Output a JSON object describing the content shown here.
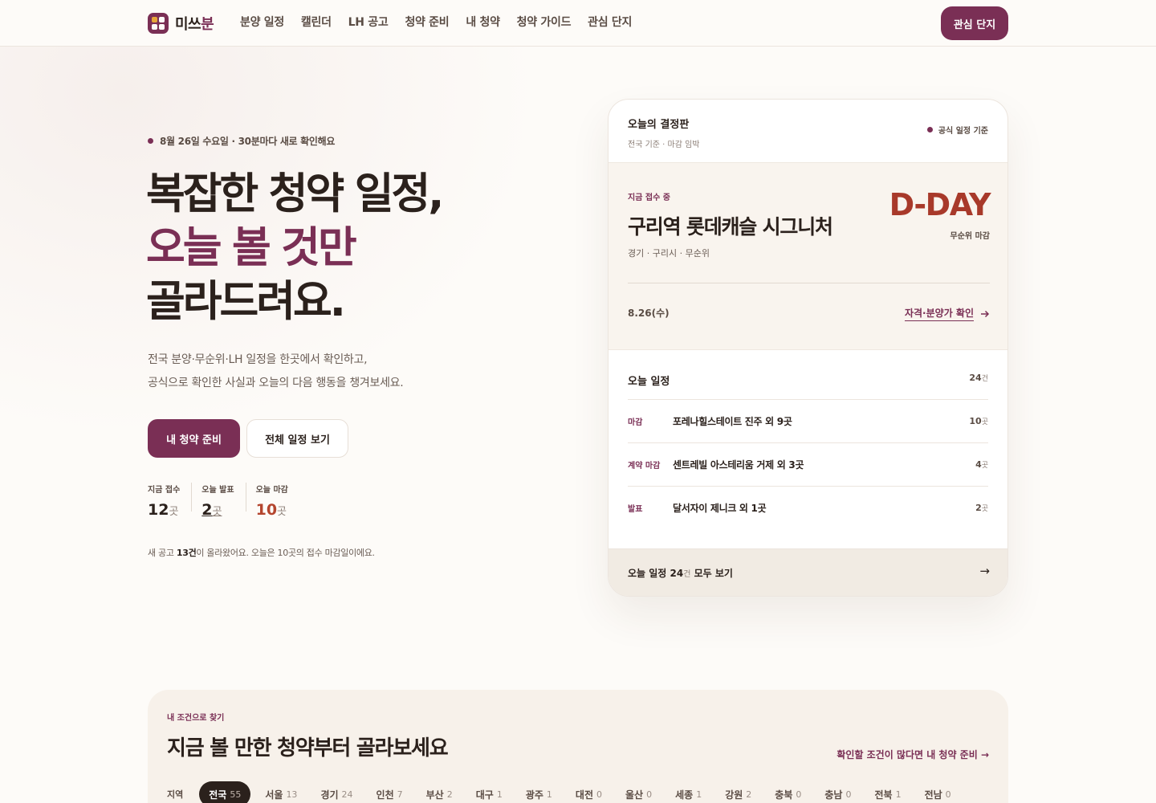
{
  "brand": {
    "name_a": "미쓰",
    "name_b": "분"
  },
  "nav": {
    "links": [
      "분양 일정",
      "캘린더",
      "LH 공고",
      "청약 준비",
      "내 청약",
      "청약 가이드",
      "관심 단지"
    ],
    "cta": "관심 단지"
  },
  "hero": {
    "eyebrow": "8월 26일 수요일 · 30분마다 새로 확인해요",
    "headline_1": "복잡한 청약 일정,",
    "headline_2": "오늘 볼 것만",
    "headline_3": "골라드려요.",
    "lead_1": "전국 분양·무순위·LH 일정을 한곳에서 확인하고,",
    "lead_2": "공식으로 확인한 사실과 오늘의 다음 행동을 챙겨보세요.",
    "primary_button": "내 청약 준비",
    "secondary_button": "전체 일정 보기",
    "stats": [
      {
        "label": "지금 접수",
        "value": "12",
        "unit": "곳"
      },
      {
        "label": "오늘 발표",
        "value": "2",
        "unit": "곳"
      },
      {
        "label": "오늘 마감",
        "value": "10",
        "unit": "곳"
      }
    ],
    "note_pre": "새 공고 ",
    "note_bold": "13건",
    "note_post": "이 올라왔어요. 오늘은 10곳의 접수 마감일이에요."
  },
  "board": {
    "title": "오늘의 결정판",
    "subtitle": "전국 기준 · 마감 임박",
    "basis": "공식 일정 기준",
    "featured": {
      "status": "지금 접수 중",
      "name": "구리역 롯데캐슬 시그니처",
      "location": "경기 · 구리시 · 무순위",
      "dday": "D-DAY",
      "dday_caption": "무순위 마감",
      "date": "8.26(수)",
      "link": "자격·분양가 확인"
    },
    "today_title": "오늘 일정",
    "today_count": "24",
    "today_unit": "건",
    "rows": [
      {
        "tag": "마감",
        "name": "포레나힐스테이트 진주 외 9곳",
        "count": "10",
        "unit": "곳"
      },
      {
        "tag": "계약 마감",
        "name": "센트레빌 아스테리움 거제 외 3곳",
        "count": "4",
        "unit": "곳"
      },
      {
        "tag": "발표",
        "name": "달서자이 제니크 외 1곳",
        "count": "2",
        "unit": "곳"
      }
    ],
    "footer_pre": "오늘 일정 ",
    "footer_num": "24",
    "footer_unit": "건",
    "footer_post": " 모두 보기",
    "footer_arrow": "→"
  },
  "filter": {
    "eyebrow": "내 조건으로 찾기",
    "title": "지금 볼 만한 청약부터 골라보세요",
    "link": "확인할 조건이 많다면 내 청약 준비 →",
    "region_label": "지역",
    "regions": [
      {
        "name": "전국",
        "count": "55"
      },
      {
        "name": "서울",
        "count": "13"
      },
      {
        "name": "경기",
        "count": "24"
      },
      {
        "name": "인천",
        "count": "7"
      },
      {
        "name": "부산",
        "count": "2"
      },
      {
        "name": "대구",
        "count": "1"
      },
      {
        "name": "광주",
        "count": "1"
      },
      {
        "name": "대전",
        "count": "0"
      },
      {
        "name": "울산",
        "count": "0"
      },
      {
        "name": "세종",
        "count": "1"
      },
      {
        "name": "강원",
        "count": "2"
      },
      {
        "name": "충북",
        "count": "0"
      },
      {
        "name": "충남",
        "count": "0"
      },
      {
        "name": "전북",
        "count": "1"
      },
      {
        "name": "전남",
        "count": "0"
      }
    ],
    "active_region": "전국"
  },
  "colors": {
    "accent": "#7a2f55",
    "danger": "#a8392a",
    "text": "#2b211c",
    "background": "#fdfbf8"
  },
  "icons": {
    "live": "dot-icon",
    "link": "arrow-right-icon"
  }
}
